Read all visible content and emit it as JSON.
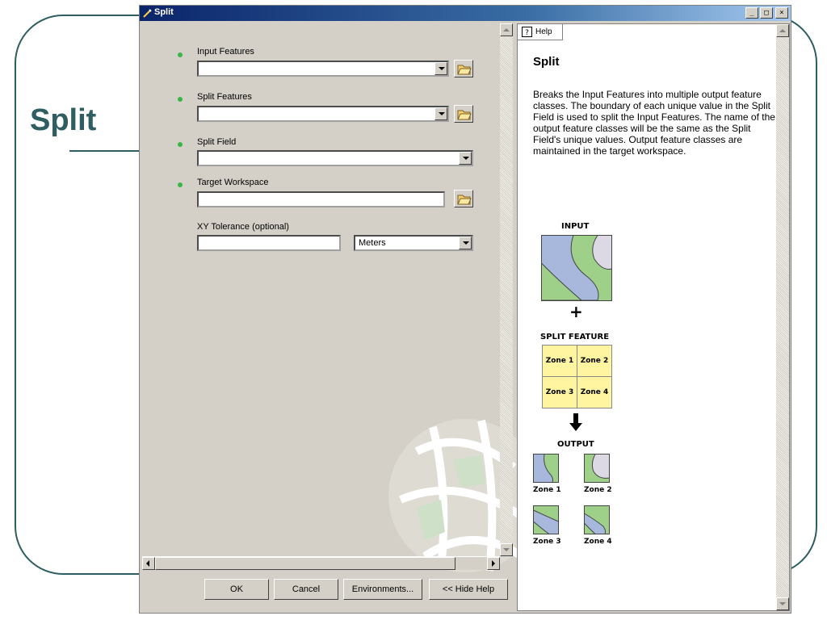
{
  "slide": {
    "title": "Split"
  },
  "window": {
    "title": "Split",
    "buttons": [
      "_",
      "□",
      "×"
    ]
  },
  "form": {
    "input_features": {
      "label": "Input Features",
      "value": ""
    },
    "split_features": {
      "label": "Split Features",
      "value": ""
    },
    "split_field": {
      "label": "Split Field",
      "value": ""
    },
    "target_workspace": {
      "label": "Target Workspace",
      "value": ""
    },
    "xy_tolerance": {
      "label": "XY Tolerance (optional)",
      "value": "",
      "units": "Meters"
    }
  },
  "buttons": {
    "ok": "OK",
    "cancel": "Cancel",
    "environments": "Environments...",
    "hide_help": "<< Hide Help"
  },
  "help": {
    "tab": "Help",
    "title": "Split",
    "body": "Breaks the Input Features into multiple output feature classes. The boundary of each unique value in the Split Field is used to split the Input Features. The name of the output feature classes will be the same as the Split Field's unique values. Output feature classes are maintained in the target workspace.",
    "diagram": {
      "input_label": "INPUT",
      "plus": "+",
      "split_label": "SPLIT FEATURE",
      "zones": [
        "Zone 1",
        "Zone 2",
        "Zone 3",
        "Zone 4"
      ],
      "output_label": "OUTPUT",
      "output_zones": [
        "Zone 1",
        "Zone 2",
        "Zone 3",
        "Zone 4"
      ]
    }
  },
  "colors": {
    "slide_accent": "#2e5d62",
    "required_dot": "#39b54a",
    "zone_fill": "#fff5a0",
    "poly_green": "#9fd08a",
    "poly_blue": "#a8b8dc",
    "poly_lavender": "#dcd8e4"
  }
}
